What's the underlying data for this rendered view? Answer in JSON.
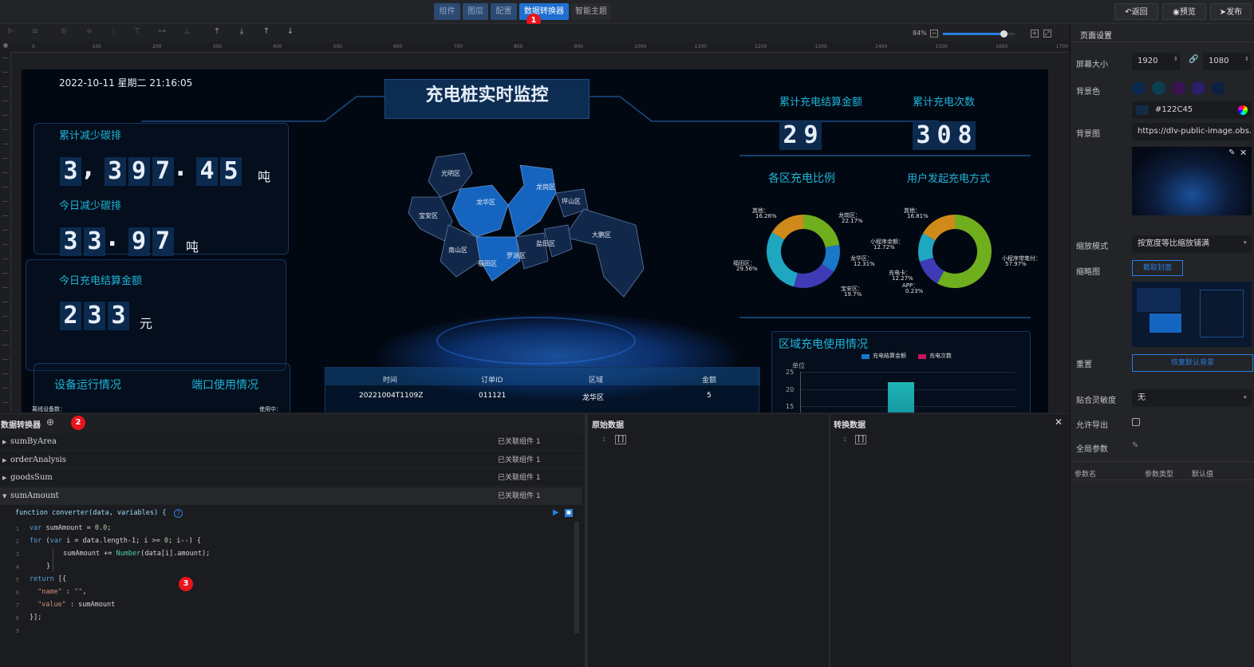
{
  "topbar": {
    "tabs": [
      "组件",
      "图层",
      "配置",
      "数据转换器",
      "智能主题"
    ],
    "active_tab": "数据转换器",
    "back_label": "返回",
    "preview_label": "预览",
    "publish_label": "发布",
    "badge1": "1"
  },
  "zoom": {
    "value": "84%",
    "level": 0.84
  },
  "ruler_ticks": [
    "0",
    "100",
    "200",
    "300",
    "400",
    "500",
    "600",
    "700",
    "800",
    "900",
    "1000",
    "1100",
    "1200",
    "1300",
    "1400",
    "1500",
    "1600",
    "1700"
  ],
  "dashboard": {
    "datetime": "2022-10-11 星期二 21:16:05",
    "title": "充电桩实时监控",
    "carbon_total_label": "累计减少碳排",
    "carbon_total_digits": [
      "3",
      ",",
      "3",
      "9",
      "7",
      ".",
      "4",
      "5"
    ],
    "carbon_total_unit": "吨",
    "carbon_today_label": "今日减少碳排",
    "carbon_today_digits": [
      "3",
      "3",
      ".",
      "9",
      "7"
    ],
    "carbon_today_unit": "吨",
    "settle_today_label": "今日充电结算金额",
    "settle_today_digits": [
      "2",
      "3",
      "3"
    ],
    "settle_today_unit": "元",
    "device_status_label": "设备运行情况",
    "port_usage_label": "端口使用情况",
    "offline_label": "离线设备数：",
    "in_use_label": "使用中：",
    "map_districts": [
      "光明区",
      "宝安区",
      "龙华区",
      "龙岗区",
      "坪山区",
      "大鹏区",
      "南山区",
      "福田区",
      "罗湖区",
      "盐田区"
    ],
    "settle_total_label": "累计充电结算金额",
    "settle_total_digits": [
      "2",
      "9"
    ],
    "charge_count_label": "累计充电次数",
    "charge_count_digits": [
      "3",
      "0",
      "8"
    ],
    "district_ratio_label": "各区充电比例",
    "user_method_label": "用户发起充电方式",
    "district_usage_label": "区域充电使用情况",
    "table": {
      "headers": [
        "时间",
        "订单ID",
        "区域",
        "金额"
      ],
      "row": [
        "20221004T1109Z",
        "011121",
        "龙华区",
        "5"
      ]
    }
  },
  "chart_data": [
    {
      "type": "pie",
      "title": "各区充电比例",
      "labels": [
        "龙岗区",
        "龙华区",
        "宝安区",
        "福田区",
        "其他"
      ],
      "values": [
        22.17,
        12.31,
        19.7,
        29.56,
        16.26
      ],
      "colors": [
        "#6fae1c",
        "#1a78c8",
        "#3f3bb5",
        "#1fa6c0",
        "#d08a1a"
      ]
    },
    {
      "type": "pie",
      "title": "用户发起充电方式",
      "labels": [
        "小程序带笔付",
        "APP",
        "充电卡",
        "小程序余额",
        "其他"
      ],
      "values": [
        57.97,
        0.23,
        12.27,
        12.72,
        16.81
      ],
      "colors": [
        "#6fae1c",
        "#1a78c8",
        "#3f3bb5",
        "#1fa6c0",
        "#d08a1a"
      ]
    },
    {
      "type": "bar",
      "title": "区域充电使用情况",
      "series": [
        {
          "name": "充电结算金额"
        },
        {
          "name": "充电次数"
        }
      ],
      "ylabel": "单位",
      "yticks": [
        "25",
        "20",
        "15"
      ],
      "ylim": [
        0,
        25
      ],
      "visible_bar_value": 22
    }
  ],
  "pie_labels": [
    {
      "name": "其他：",
      "pct": "16.26%"
    },
    {
      "name": "龙岗区：",
      "pct": "22.17%"
    },
    {
      "name": "龙华区：",
      "pct": "12.31%"
    },
    {
      "name": "福田区：",
      "pct": "29.56%"
    },
    {
      "name": "宝安区：",
      "pct": "19.7%"
    },
    {
      "name": "其他：",
      "pct": "16.81%"
    },
    {
      "name": "小程序余额：",
      "pct": "12.72%"
    },
    {
      "name": "小程序带笔付：",
      "pct": "57.97%"
    },
    {
      "name": "充电卡：",
      "pct": "12.27%"
    },
    {
      "name": "APP：",
      "pct": "0.23%"
    }
  ],
  "converter": {
    "title": "数据转换器",
    "badge2": "2",
    "badge3": "3",
    "items": [
      {
        "name": "sumByArea",
        "rel": "已关联组件 1"
      },
      {
        "name": "orderAnalysis",
        "rel": "已关联组件 1"
      },
      {
        "name": "goodsSum",
        "rel": "已关联组件 1"
      },
      {
        "name": "sumAmount",
        "rel": "已关联组件 1"
      }
    ],
    "signature": "function converter(data, variables) {",
    "line_numbers": [
      "1",
      "2",
      "3",
      "4",
      "5",
      "6",
      "7",
      "8",
      "9"
    ],
    "raw_title": "原始数据",
    "converted_title": "转换数据",
    "raw_value": "[]",
    "converted_value": "[]"
  },
  "settings": {
    "title": "页面设置",
    "screen_size_label": "屏幕大小",
    "width": "1920",
    "height": "1080",
    "bg_color_label": "背景色",
    "bg_color_value": "#122C45",
    "swatches": [
      "#0c2a4e",
      "#0a3f52",
      "#3a1450",
      "#2a1f6a",
      "#0d2040"
    ],
    "bg_image_label": "背景图",
    "bg_image_url": "https://dlv-public-image.obs.cn-",
    "scale_mode_label": "缩放模式",
    "scale_mode_value": "按宽度等比缩放铺满",
    "thumbnail_label": "缩略图",
    "capture_button": "截取封面",
    "reset_label": "重置",
    "reset_button": "恢复默认背景",
    "snap_label": "贴合灵敏度",
    "snap_value": "无",
    "allow_export_label": "允许导出",
    "global_params_label": "全局参数",
    "param_headers": [
      "参数名",
      "参数类型",
      "默认值"
    ]
  }
}
